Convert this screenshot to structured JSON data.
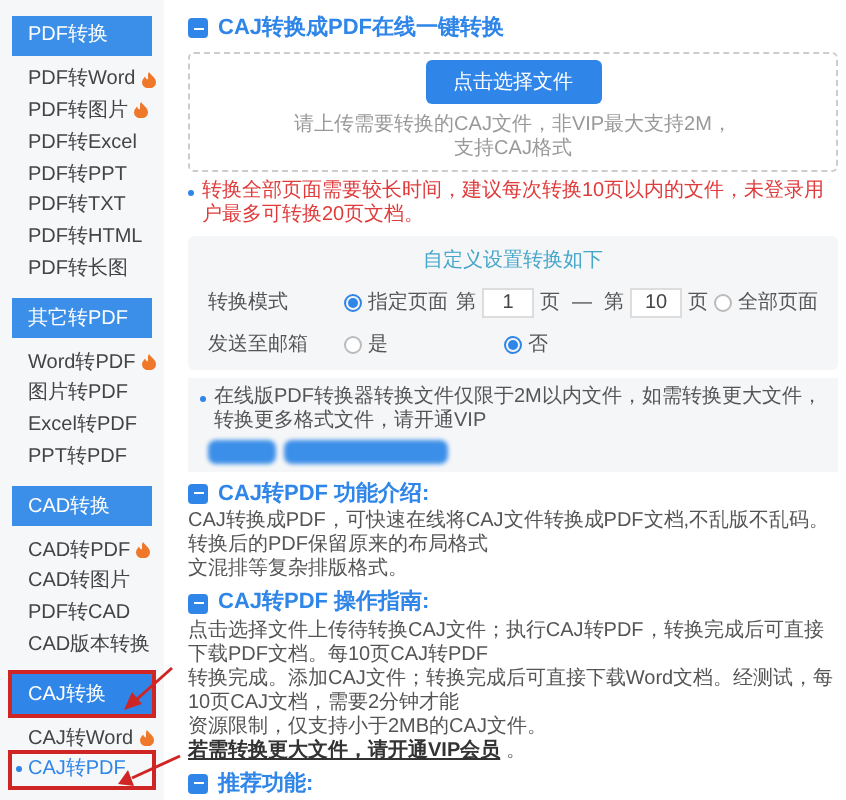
{
  "sidebar": {
    "groups": [
      {
        "title": "PDF转换",
        "selected": false,
        "items": [
          {
            "label": "PDF转Word",
            "hot": true,
            "selected": false
          },
          {
            "label": "PDF转图片",
            "hot": true,
            "selected": false
          },
          {
            "label": "PDF转Excel",
            "hot": false,
            "selected": false
          },
          {
            "label": "PDF转PPT",
            "hot": false,
            "selected": false
          },
          {
            "label": "PDF转TXT",
            "hot": false,
            "selected": false
          },
          {
            "label": "PDF转HTML",
            "hot": false,
            "selected": false
          },
          {
            "label": "PDF转长图",
            "hot": false,
            "selected": false
          }
        ]
      },
      {
        "title": "其它转PDF",
        "selected": false,
        "items": [
          {
            "label": "Word转PDF",
            "hot": true,
            "selected": false
          },
          {
            "label": "图片转PDF",
            "hot": false,
            "selected": false
          },
          {
            "label": "Excel转PDF",
            "hot": false,
            "selected": false
          },
          {
            "label": "PPT转PDF",
            "hot": false,
            "selected": false
          }
        ]
      },
      {
        "title": "CAD转换",
        "selected": false,
        "items": [
          {
            "label": "CAD转PDF",
            "hot": true,
            "selected": false
          },
          {
            "label": "CAD转图片",
            "hot": false,
            "selected": false
          },
          {
            "label": "PDF转CAD",
            "hot": false,
            "selected": false
          },
          {
            "label": "CAD版本转换",
            "hot": false,
            "selected": false
          }
        ]
      },
      {
        "title": "CAJ转换",
        "selected": true,
        "items": [
          {
            "label": "CAJ转Word",
            "hot": true,
            "selected": false
          },
          {
            "label": "CAJ转PDF",
            "hot": false,
            "selected": true
          }
        ]
      }
    ]
  },
  "title": "CAJ转换成PDF在线一键转换",
  "upload": {
    "button": "点击选择文件",
    "hint_lines": [
      "请上传需要转换的CAJ文件，非VIP最大支持2M，",
      "支持CAJ格式"
    ]
  },
  "notice": "转换全部页面需要较长时间，建议每次转换10页以内的文件，未登录用户最多可转换20页文档。",
  "settings": {
    "heading": "自定义设置转换如下",
    "rows": [
      {
        "label": "转换模式",
        "parts": [
          {
            "kind": "radio",
            "label": "指定页面",
            "selected": true
          },
          {
            "kind": "text",
            "text": "第"
          },
          {
            "kind": "input",
            "value": "1"
          },
          {
            "kind": "text",
            "text": "页"
          },
          {
            "kind": "text",
            "text": "—"
          },
          {
            "kind": "text",
            "text": "第"
          },
          {
            "kind": "input",
            "value": "10"
          },
          {
            "kind": "text",
            "text": "页"
          },
          {
            "kind": "radio",
            "label": "全部页面",
            "selected": false
          }
        ]
      },
      {
        "label": "发送至邮箱",
        "parts": [
          {
            "kind": "radio",
            "label": "是",
            "selected": false
          },
          {
            "kind": "radio",
            "label": "否",
            "selected": true
          }
        ]
      }
    ]
  },
  "vip_notice": "在线版PDF转换器转换文件仅限于2M以内文件，如需转换更大文件，转换更多格式文件，请开通VIP",
  "intro": {
    "heading": "CAJ转PDF 功能介绍:",
    "lines": [
      "CAJ转换成PDF，可快速在线将CAJ文件转换成PDF文档,不乱版不乱码。转换后的PDF保留原来的布局格式",
      "文混排等复杂排版格式。"
    ]
  },
  "guide": {
    "heading": "CAJ转PDF 操作指南:",
    "lines": [
      "点击选择文件上传待转换CAJ文件；执行CAJ转PDF，转换完成后可直接下载PDF文档。每10页CAJ转PDF",
      "转换完成。添加CAJ文件；转换完成后可直接下载Word文档。经测试，每10页CAJ文档，需要2分钟才能",
      "资源限制，仅支持小于2MB的CAJ文件。"
    ],
    "link": "若需转换更大文件，请开通VIP会员",
    "after": "。"
  },
  "recommend": {
    "heading": "推荐功能:"
  }
}
